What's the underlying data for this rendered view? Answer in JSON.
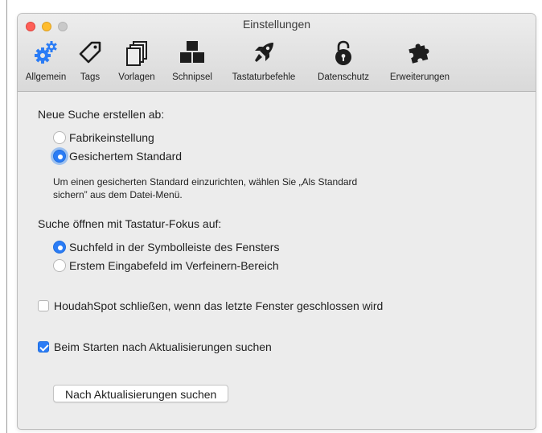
{
  "window": {
    "title": "Einstellungen"
  },
  "toolbar": {
    "items": [
      {
        "label": "Allgemein",
        "icon": "gears-icon",
        "selected": true
      },
      {
        "label": "Tags",
        "icon": "tag-icon"
      },
      {
        "label": "Vorlagen",
        "icon": "templates-icon"
      },
      {
        "label": "Schnipsel",
        "icon": "snippets-icon"
      },
      {
        "label": "Tastaturbefehle",
        "icon": "rocket-icon"
      },
      {
        "label": "Datenschutz",
        "icon": "lock-icon"
      },
      {
        "label": "Erweiterungen",
        "icon": "puzzle-icon"
      }
    ]
  },
  "new_search": {
    "title": "Neue Suche erstellen ab:",
    "options": [
      {
        "label": "Fabrikeinstellung",
        "selected": false
      },
      {
        "label": "Gesichertem Standard",
        "selected": true
      }
    ],
    "note": "Um einen gesicherten Standard einzurichten, wählen Sie „Als Standard sichern” aus dem Datei-Menü."
  },
  "focus": {
    "title": "Suche öffnen mit Tastatur-Fokus auf:",
    "options": [
      {
        "label": "Suchfeld in der Symbolleiste des Fensters",
        "selected": true
      },
      {
        "label": "Erstem Eingabefeld im Verfeinern-Bereich",
        "selected": false
      }
    ]
  },
  "close_option": {
    "label": "HoudahSpot schließen, wenn das letzte Fenster geschlossen wird",
    "checked": false
  },
  "updates": {
    "label": "Beim Starten nach Aktualisierungen suchen",
    "checked": true,
    "button": "Nach Aktualisierungen suchen"
  },
  "colors": {
    "accent": "#2b7cf5",
    "selected_icon": "#2b7cf5"
  }
}
